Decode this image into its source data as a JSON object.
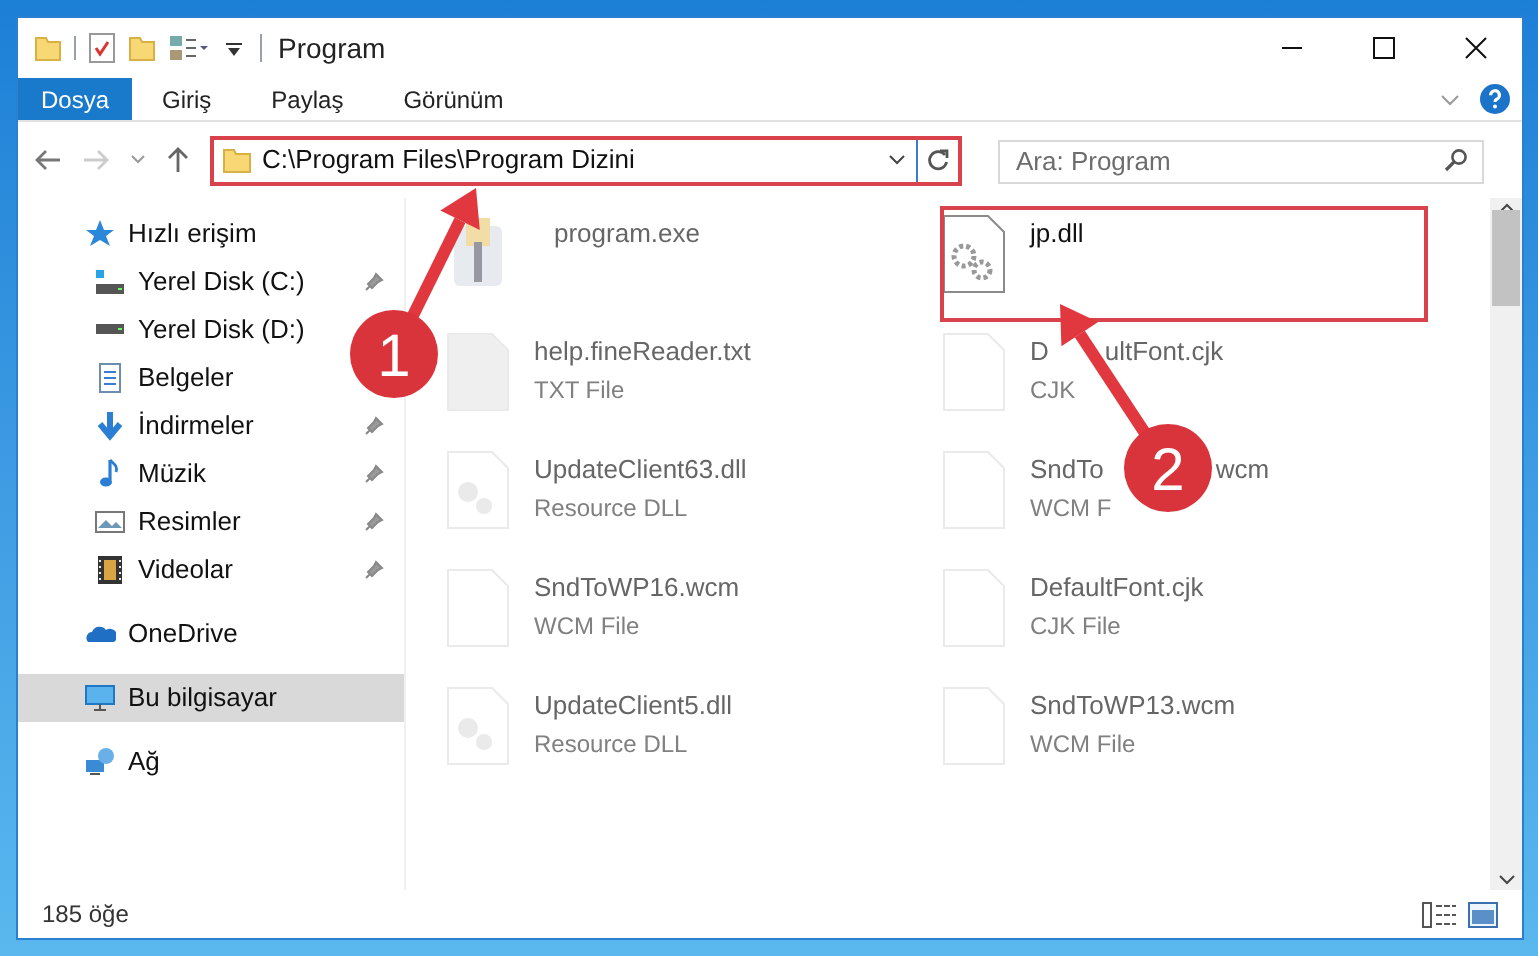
{
  "window": {
    "title": "Program"
  },
  "ribbon_tabs": [
    {
      "label": "Dosya",
      "selected": true
    },
    {
      "label": "Giriş",
      "selected": false
    },
    {
      "label": "Paylaş",
      "selected": false
    },
    {
      "label": "Görünüm",
      "selected": false
    }
  ],
  "address_bar": {
    "path": "C:\\Program Files\\Program Dizini"
  },
  "search": {
    "placeholder": "Ara: Program"
  },
  "sidebar": {
    "items": [
      {
        "label": "Hızlı erişim",
        "kind": "star",
        "selected": false,
        "children": [
          {
            "label": "Yerel Disk (C:)",
            "kind": "drive-c",
            "pinned": true
          },
          {
            "label": "Yerel Disk (D:)",
            "kind": "drive"
          },
          {
            "label": "Belgeler",
            "kind": "doc"
          },
          {
            "label": "İndirmeler",
            "kind": "download",
            "pinned": true
          },
          {
            "label": "Müzik",
            "kind": "music",
            "pinned": true
          },
          {
            "label": "Resimler",
            "kind": "pictures",
            "pinned": true
          },
          {
            "label": "Videolar",
            "kind": "video",
            "pinned": true
          }
        ]
      },
      {
        "label": "OneDrive",
        "kind": "cloud",
        "selected": false
      },
      {
        "label": "Bu bilgisayar",
        "kind": "pc",
        "selected": true
      },
      {
        "label": "Ağ",
        "kind": "network",
        "selected": false
      }
    ]
  },
  "files": [
    {
      "name": "program.exe",
      "kind": "app",
      "blurred": true
    },
    {
      "name": "jp.dll",
      "kind": "gears",
      "blurred": false
    },
    {
      "name": "help.fineReader.txt",
      "type": "TXT File",
      "kind": "txt",
      "blurred": true
    },
    {
      "name": "D",
      "name_tail": "ultFont.cjk",
      "type": "CJK",
      "kind": "blank",
      "blurred": true
    },
    {
      "name": "UpdateClient63.dll",
      "type": "Resource DLL",
      "kind": "resource",
      "blurred": true
    },
    {
      "name": "SndTo",
      "name_tail": "wcm",
      "type": "WCM F",
      "kind": "blank",
      "blurred": true
    },
    {
      "name": "SndToWP16.wcm",
      "type": "WCM File",
      "kind": "blank",
      "blurred": true
    },
    {
      "name": "DefaultFont.cjk",
      "type": "CJK File",
      "kind": "blank",
      "blurred": true
    },
    {
      "name": "UpdateClient5.dll",
      "type": "Resource DLL",
      "kind": "resource",
      "blurred": true
    },
    {
      "name": "SndToWP13.wcm",
      "type": "WCM File",
      "kind": "blank",
      "blurred": true
    }
  ],
  "status_bar": {
    "item_count": "185 öğe"
  },
  "annotations": [
    {
      "label": "1"
    },
    {
      "label": "2"
    }
  ]
}
